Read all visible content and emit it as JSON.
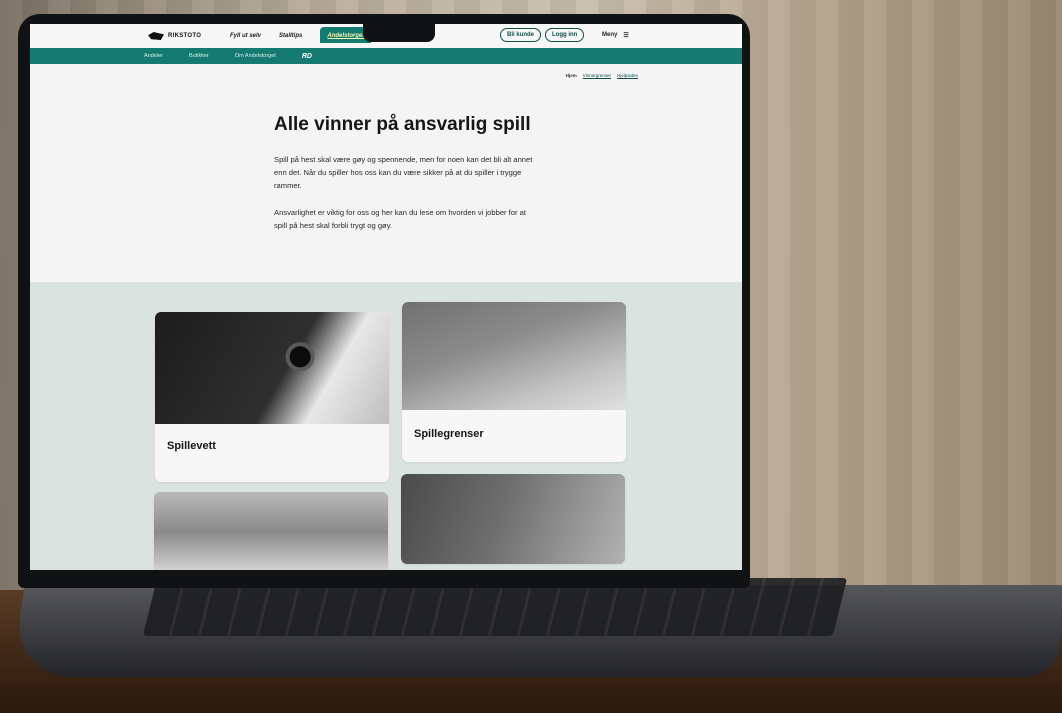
{
  "header": {
    "logo_text": "RIKSTOTO",
    "nav": [
      "Fyll ut selv",
      "Stalltips",
      "Andelstorget"
    ],
    "cta_primary": "Bli kunde",
    "cta_secondary": "Logg inn",
    "menu_label": "Meny",
    "menu_icon": "☰"
  },
  "subnav": {
    "items": [
      "Andeler",
      "Butikker",
      "Om Andelstorget"
    ],
    "rd_label": "RD"
  },
  "breadcrumb": {
    "home": "Hjem",
    "items": [
      "Vinnergrenser",
      "Hjelpsiden"
    ]
  },
  "hero": {
    "title": "Alle vinner på ansvarlig spill",
    "p1": "Spill på hest skal være gøy og spennende, men for noen kan det bli alt annet enn det. Når du spiller hos oss kan du være sikker på at du spiller i trygge rammer.",
    "p2": "Ansvarlighet er viktig for oss og her kan du lese om hvorden vi jobber for at spill på hest skal forbli trygt og gøy."
  },
  "cards": [
    {
      "title": "Spillevett"
    },
    {
      "title": "Spillegrenser"
    },
    {
      "title": ""
    },
    {
      "title": ""
    }
  ]
}
